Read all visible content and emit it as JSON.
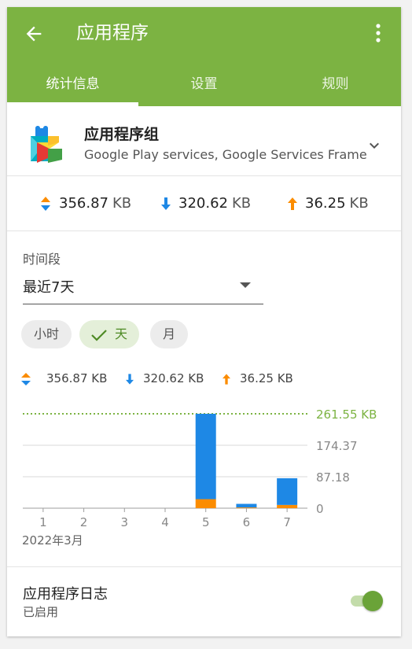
{
  "appbar": {
    "title": "应用程序",
    "back_icon": "arrow-back-icon",
    "menu_icon": "more-vert-icon",
    "color": "#7cb342"
  },
  "tabs": [
    {
      "label": "统计信息",
      "active": true
    },
    {
      "label": "设置",
      "active": false
    },
    {
      "label": "规则",
      "active": false
    }
  ],
  "app_group": {
    "name": "应用程序组",
    "subtitle": "Google Play services, Google Services Frame…",
    "icon": "google-play-services-icon",
    "expand_icon": "chevron-down-icon"
  },
  "summary": {
    "total": {
      "value": "356.87",
      "unit": "KB",
      "icon": "updown-arrows-icon"
    },
    "download": {
      "value": "320.62",
      "unit": "KB",
      "icon": "arrow-down-icon",
      "color": "#1e88e5"
    },
    "upload": {
      "value": "36.25",
      "unit": "KB",
      "icon": "arrow-up-icon",
      "color": "#fb8c00"
    }
  },
  "period": {
    "label": "时间段",
    "selected": "最近7天",
    "granularity": [
      {
        "label": "小时",
        "active": false
      },
      {
        "label": "天",
        "active": true
      },
      {
        "label": "月",
        "active": false
      }
    ]
  },
  "legend": {
    "total": "356.87 KB",
    "download": "320.62 KB",
    "upload": "36.25 KB"
  },
  "chart_data": {
    "type": "bar",
    "stacked": true,
    "categories": [
      "1",
      "2",
      "3",
      "4",
      "5",
      "6",
      "7"
    ],
    "series": [
      {
        "name": "upload",
        "color": "#fb8c00",
        "values": [
          0,
          0,
          0,
          0,
          25,
          2,
          9
        ]
      },
      {
        "name": "download",
        "color": "#1e88e5",
        "values": [
          0,
          0,
          0,
          0,
          236.6,
          10,
          74
        ]
      }
    ],
    "y_ticks": [
      "0",
      "87.18",
      "174.37"
    ],
    "max_line": {
      "label": "261.55 KB",
      "value": 261.55,
      "color": "#7cb342"
    },
    "ylim": [
      0,
      261.55
    ],
    "xlabel": "2022年3月"
  },
  "log": {
    "title": "应用程序日志",
    "status": "已启用",
    "enabled": true
  }
}
